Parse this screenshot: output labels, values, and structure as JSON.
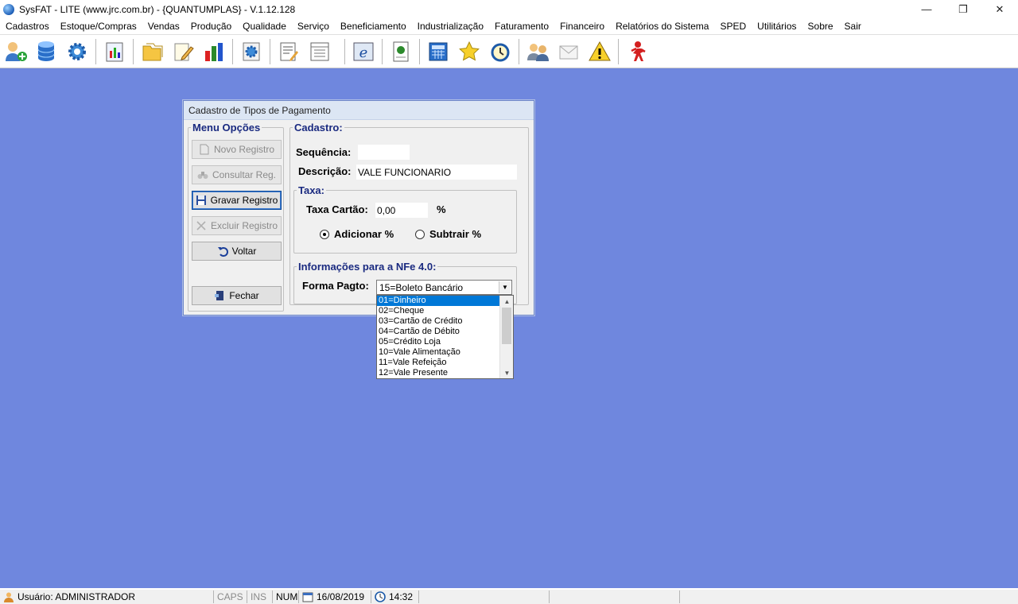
{
  "window": {
    "title": "SysFAT - LITE (www.jrc.com.br) - {QUANTUMPLAS} - V.1.12.128",
    "minimize": "—",
    "restore": "❐",
    "close": "✕"
  },
  "menu": [
    "Cadastros",
    "Estoque/Compras",
    "Vendas",
    "Produção",
    "Qualidade",
    "Serviço",
    "Beneficiamento",
    "Industrialização",
    "Faturamento",
    "Financeiro",
    "Relatórios do Sistema",
    "SPED",
    "Utilitários",
    "Sobre",
    "Sair"
  ],
  "toolbar_icons": [
    "users-add-icon",
    "database-icon",
    "gear-icon",
    "chart-book-icon",
    "folders-icon",
    "notepad-pencil-icon",
    "bar-chart-icon",
    "gear-page-icon",
    "edit-document-icon",
    "list-document-icon",
    "nfe-icon",
    "document-cert-icon",
    "calculator-icon",
    "star-icon",
    "clock-icon",
    "users-chat-icon",
    "envelope-icon",
    "warning-icon",
    "exit-man-icon"
  ],
  "dialog": {
    "title": "Cadastro de Tipos de Pagamento",
    "menu_legend": "Menu Opções",
    "buttons": {
      "novo": "Novo Registro",
      "consultar": "Consultar Reg.",
      "gravar": "Gravar Registro",
      "excluir": "Excluir Registro",
      "voltar": "Voltar",
      "fechar": "Fechar"
    },
    "cadastro_legend": "Cadastro:",
    "sequencia_label": "Sequência:",
    "sequencia_value": "",
    "descricao_label": "Descrição:",
    "descricao_value": "VALE FUNCIONARIO",
    "taxa_legend": "Taxa:",
    "taxa_label": "Taxa Cartão:",
    "taxa_value": "0,00",
    "percent": "%",
    "adicionar_label": "Adicionar %",
    "subtrair_label": "Subtrair %",
    "selected_option": "adicionar",
    "nfe_legend": "Informações para a NFe 4.0:",
    "forma_label": "Forma Pagto:",
    "forma_value": "15=Boleto Bancário",
    "forma_options": [
      "01=Dinheiro",
      "02=Cheque",
      "03=Cartão de Crédito",
      "04=Cartão de Débito",
      "05=Crédito Loja",
      "10=Vale Alimentação",
      "11=Vale Refeição",
      "12=Vale Presente"
    ],
    "highlighted_option": "01=Dinheiro"
  },
  "status": {
    "user": "Usuário: ADMINISTRADOR",
    "caps": "CAPS",
    "ins": "INS",
    "num": "NUM",
    "date": "16/08/2019",
    "time": "14:32"
  },
  "colors": {
    "desktop": "#6f87de",
    "legend": "#1a2a80",
    "selection": "#0078d7"
  }
}
